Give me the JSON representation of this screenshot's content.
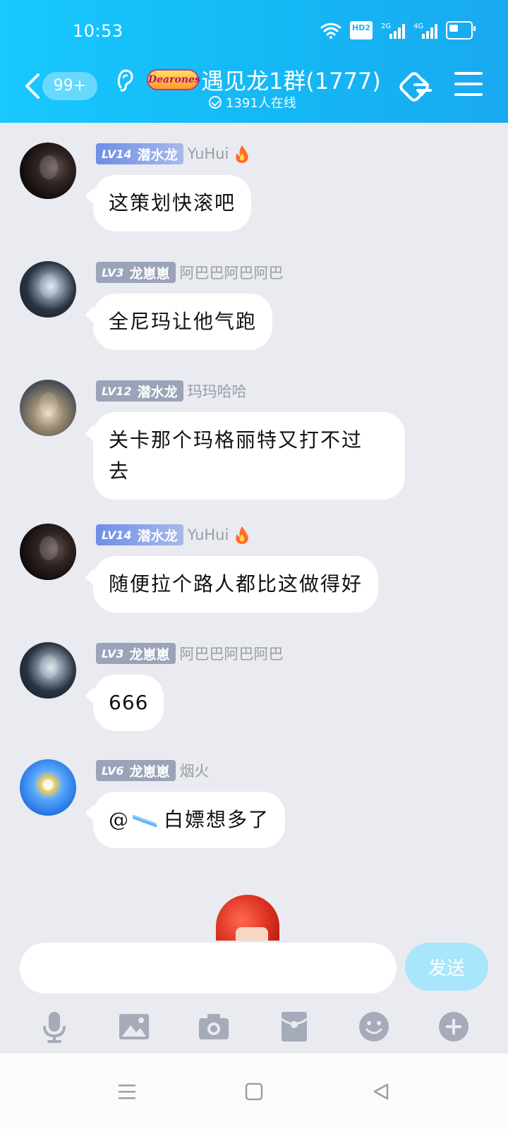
{
  "status_bar": {
    "time": "10:53",
    "hd_label": "HD2",
    "signal_1_label": "2G",
    "signal_2_label": "4G",
    "icons": [
      "wifi-icon",
      "hd-icon",
      "signal-2g-icon",
      "signal-4g-icon",
      "battery-icon"
    ]
  },
  "header": {
    "unread_count": "99+",
    "brand_logo_text": "Dearones",
    "group_name": "遇见龙1群(1777)",
    "online_text": "1391人在线",
    "colors": {
      "header_gradient_start": "#18c8ff",
      "header_gradient_end": "#1aa9f0"
    }
  },
  "messages": [
    {
      "avatar": "dark-portrait",
      "level": "LV14",
      "title": "潜水龙",
      "nickname": "YuHui",
      "has_fire": true,
      "badge_style": "blue",
      "text": "这策划快滚吧"
    },
    {
      "avatar": "ghost-figure",
      "level": "LV3",
      "title": "龙崽崽",
      "nickname": "阿巴巴阿巴阿巴",
      "has_fire": false,
      "badge_style": "gray",
      "text": "全尼玛让他气跑"
    },
    {
      "avatar": "anime-boy",
      "level": "LV12",
      "title": "潜水龙",
      "nickname": "玛玛哈哈",
      "has_fire": false,
      "badge_style": "gray",
      "text_line1": "关卡那个玛格丽特又打不过",
      "text_line2": "去"
    },
    {
      "avatar": "dark-portrait",
      "level": "LV14",
      "title": "潜水龙",
      "nickname": "YuHui",
      "has_fire": true,
      "badge_style": "blue",
      "text": "随便拉个路人都比这做得好"
    },
    {
      "avatar": "ghost-figure",
      "level": "LV3",
      "title": "龙崽崽",
      "nickname": "阿巴巴阿巴阿巴",
      "has_fire": false,
      "badge_style": "gray",
      "text": "666"
    },
    {
      "avatar": "daisy-sky",
      "level": "LV6",
      "title": "龙崽崽",
      "nickname": "烟火",
      "has_fire": false,
      "badge_style": "gray",
      "mention_prefix": "@",
      "text": "白嫖想多了"
    }
  ],
  "input": {
    "placeholder": "",
    "send_label": "发送"
  },
  "toolbar": {
    "items": [
      "microphone-icon",
      "image-icon",
      "camera-icon",
      "red-packet-icon",
      "emoji-icon",
      "plus-icon"
    ]
  },
  "system_nav": {
    "items": [
      "menu-icon",
      "home-icon",
      "back-icon"
    ]
  }
}
